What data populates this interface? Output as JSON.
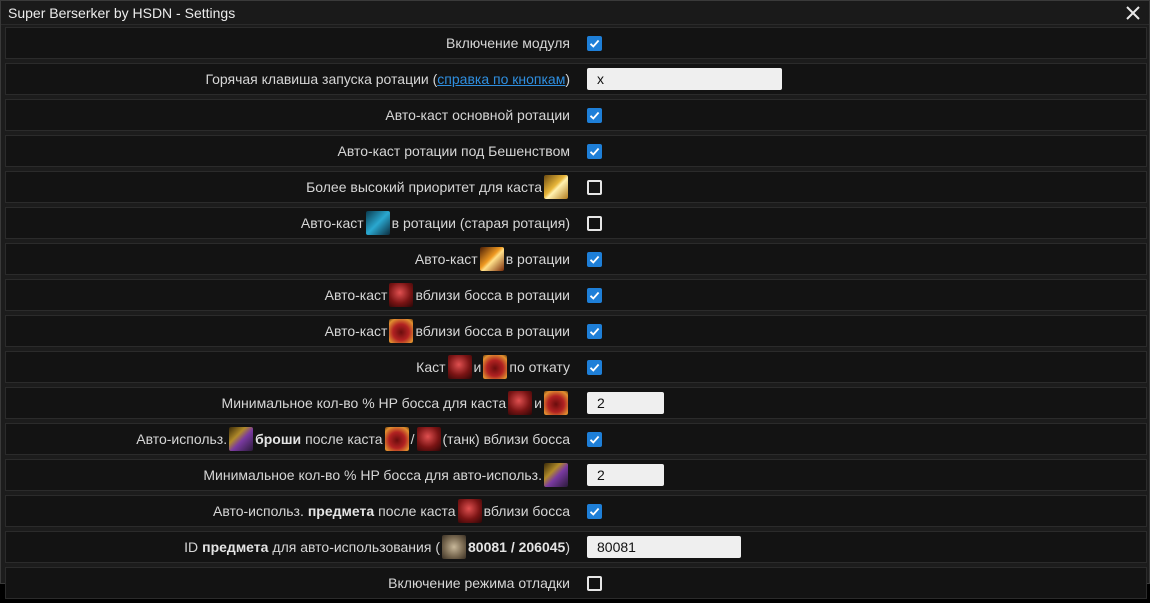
{
  "window": {
    "title": "Super Berserker by HSDN - Settings"
  },
  "rows": {
    "r0": {
      "label": "Включение модуля",
      "checked": true
    },
    "r1": {
      "label_pre": "Горячая клавиша запуска ротации (",
      "link": "справка по кнопкам",
      "label_post": ")",
      "value": "x"
    },
    "r2": {
      "label": "Авто-каст основной ротации",
      "checked": true
    },
    "r3": {
      "label": "Авто-каст ротации под Бешенством",
      "checked": true
    },
    "r4": {
      "label": "Более высокий приоритет для каста",
      "icon": "gold-crossed-axes-skill-icon",
      "checked": false
    },
    "r5": {
      "label_pre": "Авто-каст",
      "label_post": "в ротации (старая ротация)",
      "icon": "blue-dash-skill-icon",
      "checked": false
    },
    "r6": {
      "label_pre": "Авто-каст",
      "label_post": "в ротации",
      "icon": "fire-slash-skill-icon",
      "checked": true
    },
    "r7": {
      "label_pre": "Авто-каст",
      "label_post": "вблизи босса в ротации",
      "icon": "red-berserker-skill-icon",
      "checked": true
    },
    "r8": {
      "label_pre": "Авто-каст",
      "label_post": "вблизи босса в ротации",
      "icon": "red-frame-skill-icon",
      "checked": true
    },
    "r9": {
      "label_pre": "Каст",
      "label_mid": "и",
      "label_post": "по откату",
      "icon1": "red-berserker-skill-icon",
      "icon2": "red-frame-skill-icon",
      "checked": true
    },
    "r10": {
      "label_pre": "Минимальное кол-во % HP босса для каста",
      "label_mid": "и",
      "icon1": "red-berserker-skill-icon",
      "icon2": "red-frame-skill-icon",
      "value": "2"
    },
    "r11": {
      "label_pre": "Авто-использ.",
      "bold": "броши",
      "label_mid": "после каста",
      "slash": "/",
      "label_post": "(танк) вблизи босса",
      "icon_brooch": "brooch-icon",
      "icon1": "red-frame-skill-icon",
      "icon2": "red-berserker-skill-icon",
      "checked": true
    },
    "r12": {
      "label": "Минимальное кол-во % HP босса для авто-использ.",
      "icon": "brooch-icon",
      "value": "2"
    },
    "r13": {
      "label_pre": "Авто-использ.",
      "bold": "предмета",
      "label_mid": "после каста",
      "label_post": "вблизи босса",
      "icon": "red-berserker-skill-icon",
      "checked": true
    },
    "r14": {
      "label_pre": "ID",
      "bold": "предмета",
      "label_mid": "для авто-использования (",
      "ids": "80081 / 206045",
      "label_post": ")",
      "icon": "item-icon",
      "value": "80081"
    },
    "r15": {
      "label": "Включение режима отладки",
      "checked": false
    }
  },
  "colors": {
    "accent": "#1e7fd8",
    "link": "#2f8fe0",
    "background": "#1c1c1c",
    "row_background": "#131313"
  }
}
